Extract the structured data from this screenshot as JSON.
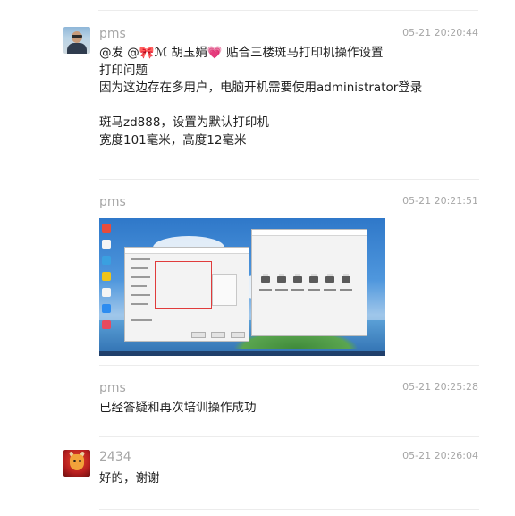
{
  "messages": [
    {
      "username": "pms",
      "time": "05-21 20:20:44",
      "avatar": "user-photo-avatar",
      "mention_prefix": "@发 @",
      "mention_icon": "bow-emoji",
      "mention_name": "ℳ 胡玉娟",
      "mention_heart": "heart-emoji",
      "mention_suffix": " 贴合三楼斑马打印机操作设置",
      "lines": [
        "打印问题",
        "因为这边存在多用户，电脑开机需要使用administrator登录",
        "",
        "斑马zd888，设置为默认打印机",
        "宽度101毫米，高度12毫米"
      ]
    },
    {
      "username": "pms",
      "time": "05-21 20:21:51",
      "attachment": "screenshot-image"
    },
    {
      "username": "pms",
      "time": "05-21 20:25:28",
      "text": "已经答疑和再次培训操作成功"
    },
    {
      "username": "2434",
      "time": "05-21 20:26:04",
      "avatar": "dragon-avatar",
      "text": "好的，谢谢"
    }
  ],
  "colors": {
    "meta_text": "#a6a6a6",
    "body_text": "#1f1f1f",
    "divider": "#ececec",
    "highlight_box": "#e03b3b"
  }
}
